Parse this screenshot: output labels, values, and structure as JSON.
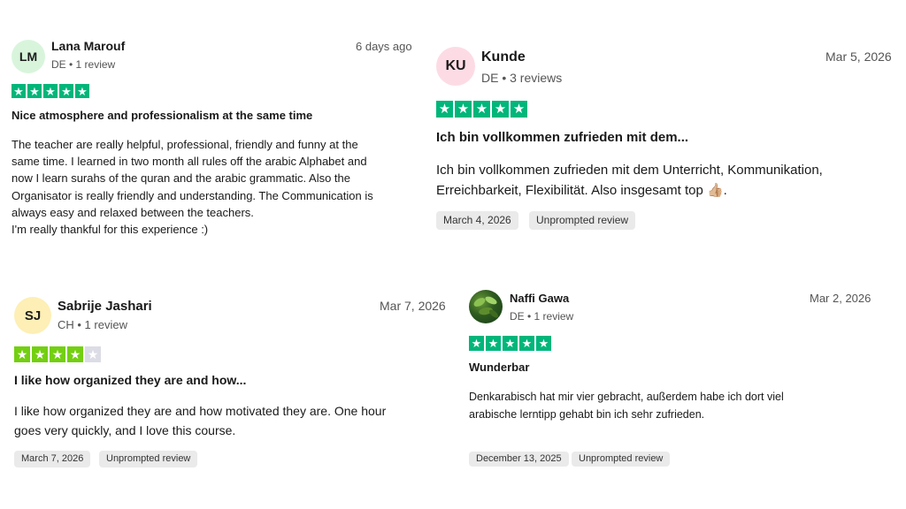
{
  "colors": {
    "star_five": "#00b67a",
    "star_four": "#73cf11",
    "star_empty": "#dcdce6"
  },
  "reviews": [
    {
      "initials": "LM",
      "name": "Lana Marouf",
      "meta": "DE • 1 review",
      "date": "6 days ago",
      "rating": 5,
      "title": "Nice atmosphere and professionalism at the same time",
      "body_lines": [
        "The teacher are really helpful, professional, friendly and funny at the",
        "same time. I learned in two month all rules off the arabic Alphabet and",
        "now I learn surahs of the quran and the arabic grammatic. Also the",
        "Organisator is really friendly and understanding. The Communication is",
        "always easy and relaxed between the teachers.",
        "I'm really thankful for this experience :)"
      ]
    },
    {
      "initials": "KU",
      "name": "Kunde",
      "meta": "DE • 3 reviews",
      "date": "Mar 5, 2026",
      "rating": 5,
      "title": "Ich bin vollkommen zufrieden mit dem...",
      "body_lines": [
        "Ich bin vollkommen zufrieden mit dem Unterricht, Kommunikation,",
        "Erreichbarkeit, Flexibilität. Also insgesamt top 👍🏼."
      ],
      "experience_date": "March 4, 2026",
      "review_type": "Unprompted review"
    },
    {
      "initials": "SJ",
      "name": "Sabrije Jashari",
      "meta": "CH • 1 review",
      "date": "Mar 7, 2026",
      "rating": 4,
      "title": "I like how organized they are and how...",
      "body_lines": [
        "I like how organized they are and how motivated they are. One hour",
        "goes very quickly, and I love this course."
      ],
      "experience_date": "March 7, 2026",
      "review_type": "Unprompted review"
    },
    {
      "avatar_icon": "plant-photo-avatar",
      "name": "Naffi Gawa",
      "meta": "DE • 1 review",
      "date": "Mar 2, 2026",
      "rating": 5,
      "title": "Wunderbar",
      "body_lines": [
        "Denkarabisch hat mir vier gebracht, außerdem habe ich dort viel",
        "arabische lerntipp gehabt bin ich sehr zufrieden."
      ],
      "experience_date": "December 13, 2025",
      "review_type": "Unprompted review"
    }
  ]
}
